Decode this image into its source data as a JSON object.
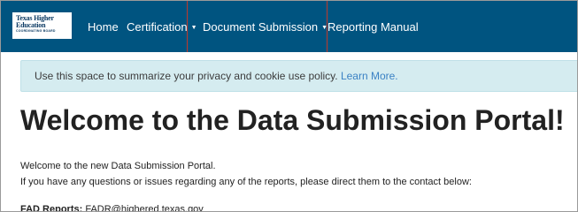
{
  "navbar": {
    "logo": {
      "line1": "Texas Higher",
      "line2": "Education",
      "line3": "COORDINATING BOARD"
    },
    "items": [
      {
        "label": "Home",
        "has_dropdown": false
      },
      {
        "label": "Certification",
        "has_dropdown": true
      },
      {
        "label": "Document Submission",
        "has_dropdown": true
      },
      {
        "label": "Reporting Manual",
        "has_dropdown": false
      }
    ],
    "caret_glyph": "▼"
  },
  "cookie_alert": {
    "text": "Use this space to summarize your privacy and cookie use policy.",
    "link_label": "Learn More."
  },
  "main": {
    "title": "Welcome to the Data Submission Portal!",
    "intro": "Welcome to the new Data Submission Portal.",
    "help": "If you have any questions or issues regarding any of the reports, please direct them to the contact below:",
    "contact_label": "FAD Reports:",
    "contact_value": "FADR@highered.texas.gov"
  },
  "colors": {
    "navbar_bg": "#005480",
    "alert_bg": "#d5ecf0",
    "link": "#3b82c4",
    "highlight_border": "#c0392b"
  }
}
